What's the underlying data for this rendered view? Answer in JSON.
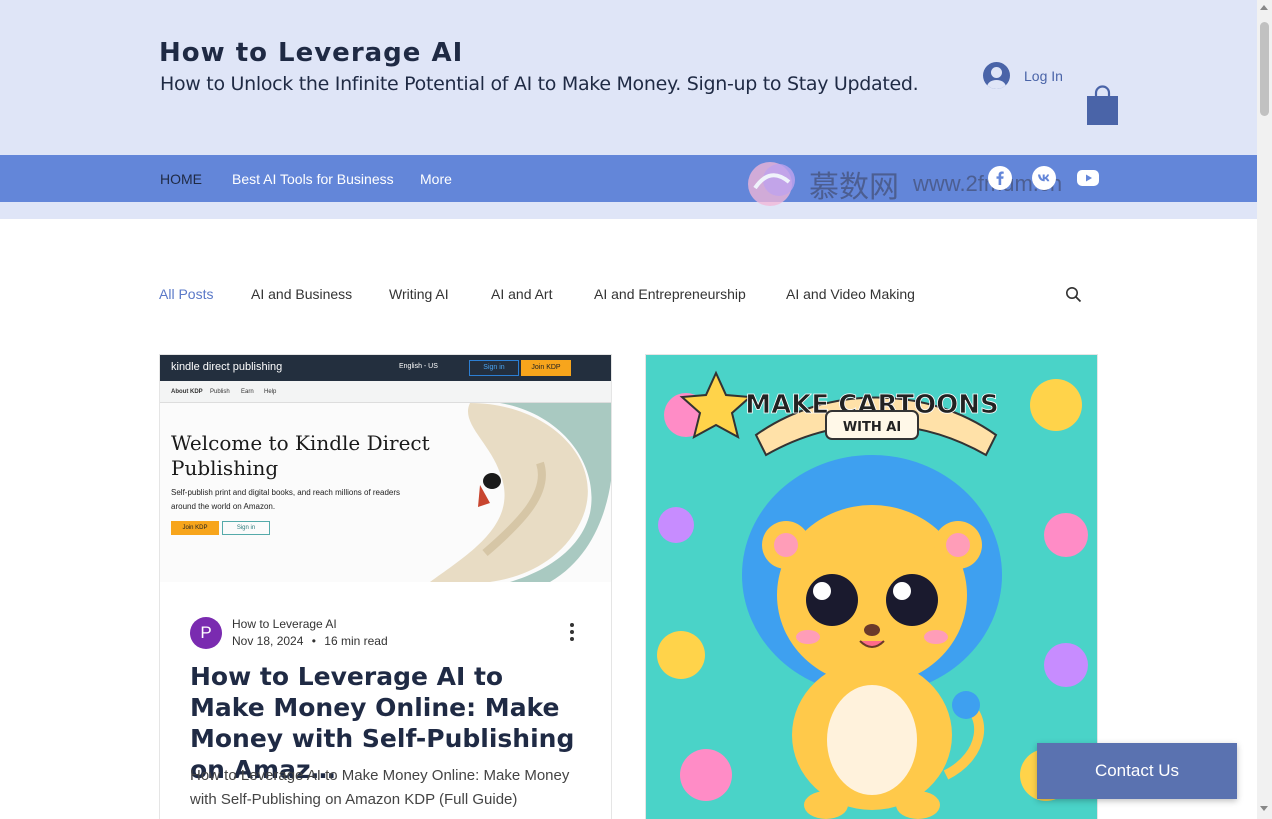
{
  "header": {
    "title": "How to Leverage AI",
    "tagline": "How to Unlock the Infinite Potential of AI to Make Money. Sign-up to Stay Updated.",
    "login_label": "Log In"
  },
  "nav": {
    "items": [
      "HOME",
      "Best AI Tools for Business",
      "More"
    ]
  },
  "watermark": {
    "text": "慕数网",
    "url": "www.2fmum.cn"
  },
  "categories": [
    "All Posts",
    "AI and Business",
    "Writing AI",
    "AI and Art",
    "AI and Entrepreneurship",
    "AI and Video Making"
  ],
  "posts": [
    {
      "author_initial": "P",
      "author": "How to Leverage AI",
      "date": "Nov 18, 2024",
      "separator": "•",
      "read_time": "16 min read",
      "title": "How to Leverage AI to Make Money Online: Make Money with Self-Publishing on Amaz…",
      "excerpt": "How to Leverage AI to Make Money Online: Make Money with Self-Publishing on Amazon KDP (Full Guide)",
      "image": {
        "brand": "kindle direct publishing",
        "lang": "English - US",
        "sign_in": "Sign in",
        "join": "Join KDP",
        "subnav": [
          "About KDP",
          "Publish",
          "Earn",
          "Help"
        ],
        "headline": "Welcome to Kindle Direct Publishing",
        "description": "Self-publish print and digital books, and reach millions of readers around the world on Amazon.",
        "join_button": "Join KDP",
        "sign_in_button": "Sign in"
      }
    },
    {
      "image": {
        "banner": "MAKE CARTOONS",
        "ribbon": "WITH AI"
      }
    }
  ],
  "contact_button": "Contact Us",
  "colors": {
    "header_bg": "#dfe5f7",
    "nav_bg": "#6386d9",
    "accent": "#4a64a8",
    "contact_bg": "#5a72b0",
    "avatar": "#7a2bb0"
  }
}
